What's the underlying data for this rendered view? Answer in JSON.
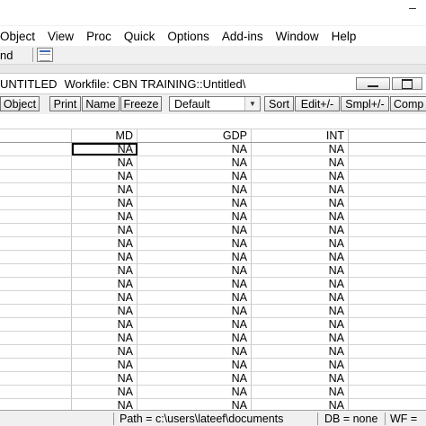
{
  "window": {
    "close_glyph": "–"
  },
  "menubar": {
    "items": [
      "Object",
      "View",
      "Proc",
      "Quick",
      "Options",
      "Add-ins",
      "Window",
      "Help"
    ]
  },
  "command": {
    "label": "nd"
  },
  "workfile": {
    "name": "UNTITLED",
    "title": "Workfile: CBN TRAINING::Untitled\\"
  },
  "toolbar": {
    "buttons": [
      "Object",
      "Print",
      "Name",
      "Freeze",
      "Sort",
      "Edit+/-",
      "Smpl+/-",
      "Comp"
    ],
    "display_format": "Default",
    "dropdown_glyph": "▼"
  },
  "grid": {
    "columns": [
      "",
      "MD",
      "GDP",
      "INT",
      ""
    ],
    "missing_value": "NA",
    "row_count": 20
  },
  "statusbar": {
    "path": "Path = c:\\users\\lateef\\documents",
    "db": "DB = none",
    "wf": "WF ="
  },
  "colors": {
    "frame_bg": "#f0f0f0",
    "grid_line": "#d4d4d4",
    "active_cell_border": "#000000"
  }
}
